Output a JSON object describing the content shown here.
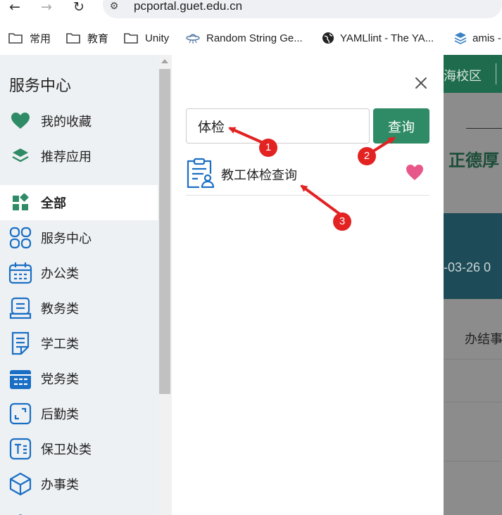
{
  "browser": {
    "url": "pcportal.guet.edu.cn",
    "bookmarks": [
      {
        "label": "常用",
        "icon": "folder-icon"
      },
      {
        "label": "教育",
        "icon": "folder-icon"
      },
      {
        "label": "Unity",
        "icon": "folder-icon"
      },
      {
        "label": "Random String Ge...",
        "icon": "ufo-icon"
      },
      {
        "label": "YAMLlint - The YA...",
        "icon": "globe-icon"
      },
      {
        "label": "amis -",
        "icon": "layers-icon"
      }
    ]
  },
  "sidebar": {
    "title": "服务中心",
    "items": [
      {
        "label": "我的收藏",
        "icon": "heart-icon"
      },
      {
        "label": "推荐应用",
        "icon": "layers-icon"
      },
      {
        "label": "全部",
        "icon": "grid-icon",
        "active": true
      },
      {
        "label": "服务中心",
        "icon": "apps-icon"
      },
      {
        "label": "办公类",
        "icon": "calendar-icon"
      },
      {
        "label": "教务类",
        "icon": "inbox-icon"
      },
      {
        "label": "学工类",
        "icon": "document-icon"
      },
      {
        "label": "党务类",
        "icon": "calendar-filled-icon"
      },
      {
        "label": "后勤类",
        "icon": "expand-icon"
      },
      {
        "label": "保卫处类",
        "icon": "text-icon"
      },
      {
        "label": "办事类",
        "icon": "cube-icon"
      }
    ]
  },
  "background_page": {
    "campus": "海校区",
    "motto": "正德厚",
    "date": "-03-26 0",
    "status": "办结事"
  },
  "search_modal": {
    "query": "体检",
    "search_button": "查询",
    "results": [
      {
        "label": "教工体检查询",
        "icon": "clipboard-user-icon",
        "favorited": true
      }
    ]
  },
  "annotations": [
    "1",
    "2",
    "3"
  ],
  "colors": {
    "primary_green": "#2e8b65",
    "heart_pink": "#e8578a",
    "icon_blue": "#1a6fc4",
    "annotation_red": "#e32222"
  }
}
